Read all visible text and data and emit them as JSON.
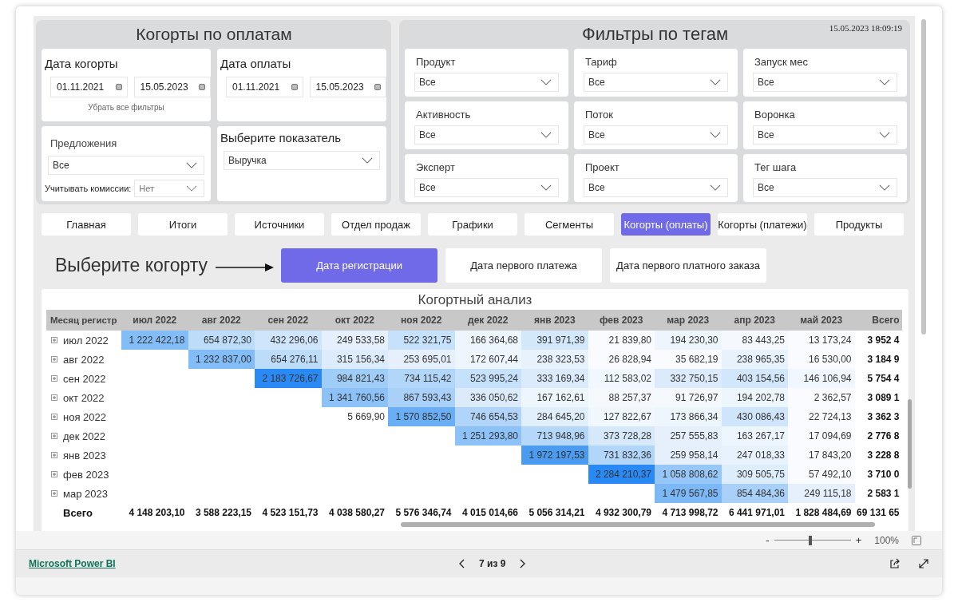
{
  "left_panel": {
    "title": "Когорты по оплатам",
    "cohort_date": {
      "label": "Дата когорты",
      "from": "01.11.2021",
      "to": "15.05.2023"
    },
    "clear_filters": "Убрать все фильтры",
    "payment_date": {
      "label": "Дата оплаты",
      "from": "01.11.2021",
      "to": "15.05.2023"
    },
    "offers": {
      "label": "Предложения",
      "value": "Все"
    },
    "commission": {
      "label": "Учитывать комиссии:",
      "value": "Нет"
    },
    "metric": {
      "label": "Выберите показатель",
      "value": "Выручка"
    }
  },
  "right_panel": {
    "title": "Фильтры по тегам",
    "timestamp": "15.05.2023 18:09:19",
    "filters": [
      {
        "label": "Продукт",
        "value": "Все"
      },
      {
        "label": "Тариф",
        "value": "Все"
      },
      {
        "label": "Запуск мес",
        "value": "Все"
      },
      {
        "label": "Активность",
        "value": "Все"
      },
      {
        "label": "Поток",
        "value": "Все"
      },
      {
        "label": "Воронка",
        "value": "Все"
      },
      {
        "label": "Эксперт",
        "value": "Все"
      },
      {
        "label": "Проект",
        "value": "Все"
      },
      {
        "label": "Тег шага",
        "value": "Все"
      }
    ]
  },
  "nav_tabs": [
    {
      "label": "Главная",
      "selected": false
    },
    {
      "label": "Итоги",
      "selected": false
    },
    {
      "label": "Источники",
      "selected": false
    },
    {
      "label": "Отдел продаж",
      "selected": false
    },
    {
      "label": "Графики",
      "selected": false
    },
    {
      "label": "Сегменты",
      "selected": false
    },
    {
      "label": "Когорты (оплаты)",
      "selected": true
    },
    {
      "label": "Когорты (платежи)",
      "selected": false
    },
    {
      "label": "Продукты",
      "selected": false
    }
  ],
  "cohort_picker": {
    "label": "Выберите когорту",
    "options": [
      {
        "label": "Дата регистрации",
        "selected": true
      },
      {
        "label": "Дата первого платежа",
        "selected": false
      },
      {
        "label": "Дата первого платного заказа",
        "selected": false
      }
    ]
  },
  "table": {
    "title": "Когортный анализ",
    "row_header": "Месяц регистр",
    "columns": [
      "июл 2022",
      "авг 2022",
      "сен 2022",
      "окт 2022",
      "ноя 2022",
      "дек 2022",
      "янв 2023",
      "фев 2023",
      "мар 2023",
      "апр 2023",
      "май 2023"
    ],
    "total_header": "Всего",
    "rows": [
      {
        "label": "июл 2022",
        "total": "3 952 4",
        "cells": [
          {
            "text": "1 222 422,18",
            "color": "#82bdf8"
          },
          {
            "text": "654 872,30",
            "color": "#bcdcfa"
          },
          {
            "text": "432 296,06",
            "color": "#cfe5fb"
          },
          {
            "text": "249 533,58",
            "color": "#e5f0fc"
          },
          {
            "text": "522 321,75",
            "color": "#c6e1fb"
          },
          {
            "text": "166 364,68",
            "color": "#edf5fd"
          },
          {
            "text": "391 971,39",
            "color": "#d4e8fb"
          },
          {
            "text": "21 839,80",
            "color": "#f9fbff"
          },
          {
            "text": "194 230,30",
            "color": "#edf5fd"
          },
          {
            "text": "83 443,25",
            "color": "#f5f9fe"
          },
          {
            "text": "13 173,24",
            "color": "#f9fbff"
          }
        ]
      },
      {
        "label": "авг 2022",
        "total": "3 184 9",
        "cells": [
          null,
          {
            "text": "1 232 837,00",
            "color": "#82bdf8"
          },
          {
            "text": "654 276,11",
            "color": "#bcdcfa"
          },
          {
            "text": "315 156,34",
            "color": "#ddecfc"
          },
          {
            "text": "253 695,01",
            "color": "#e5f0fc"
          },
          {
            "text": "172 607,44",
            "color": "#edf5fd"
          },
          {
            "text": "238 323,53",
            "color": "#e7f2fd"
          },
          {
            "text": "26 828,94",
            "color": "#f9fbff"
          },
          {
            "text": "35 682,19",
            "color": "#f9fbff"
          },
          {
            "text": "238 965,35",
            "color": "#e7f2fd"
          },
          {
            "text": "16 530,00",
            "color": "#f9fbff"
          }
        ]
      },
      {
        "label": "сен 2022",
        "total": "5 754 4",
        "cells": [
          null,
          null,
          {
            "text": "2 183 726,67",
            "color": "#2a8af5"
          },
          {
            "text": "984 821,43",
            "color": "#a0ccf8"
          },
          {
            "text": "734 115,42",
            "color": "#b2d6fa"
          },
          {
            "text": "523 995,24",
            "color": "#c6e1fb"
          },
          {
            "text": "333 169,34",
            "color": "#dbebfc"
          },
          {
            "text": "112 583,02",
            "color": "#f1f7fe"
          },
          {
            "text": "332 750,15",
            "color": "#dbebfc"
          },
          {
            "text": "403 154,56",
            "color": "#d2e7fb"
          },
          {
            "text": "146 106,94",
            "color": "#f1f7fe"
          }
        ]
      },
      {
        "label": "окт 2022",
        "total": "3 089 1",
        "cells": [
          null,
          null,
          null,
          {
            "text": "1 341 760,56",
            "color": "#8cc2f8"
          },
          {
            "text": "867 593,43",
            "color": "#a8d0f8"
          },
          {
            "text": "336 050,62",
            "color": "#dbebfc"
          },
          {
            "text": "167 162,61",
            "color": "#edf5fd"
          },
          {
            "text": "88 257,37",
            "color": "#f5f9fe"
          },
          {
            "text": "91 726,97",
            "color": "#f5f9fe"
          },
          {
            "text": "194 202,78",
            "color": "#edf5fd"
          },
          {
            "text": "2 362,57",
            "color": "#f9fbff"
          }
        ]
      },
      {
        "label": "ноя 2022",
        "total": "3 362 3",
        "cells": [
          null,
          null,
          null,
          {
            "text": "5 669,90",
            "color": "#ffffff"
          },
          {
            "text": "1 570 852,50",
            "color": "#6aaef5"
          },
          {
            "text": "746 654,53",
            "color": "#b0d4fa"
          },
          {
            "text": "284 645,20",
            "color": "#e1eefc"
          },
          {
            "text": "127 822,67",
            "color": "#f1f7fe"
          },
          {
            "text": "173 866,34",
            "color": "#edf5fd"
          },
          {
            "text": "430 086,43",
            "color": "#cfe5fb"
          },
          {
            "text": "22 724,13",
            "color": "#f9fbff"
          }
        ]
      },
      {
        "label": "дек 2022",
        "total": "2 776 8",
        "cells": [
          null,
          null,
          null,
          null,
          null,
          {
            "text": "1 251 293,80",
            "color": "#8cc2f8"
          },
          {
            "text": "713 948,96",
            "color": "#b4d7fa"
          },
          {
            "text": "373 728,28",
            "color": "#d6e9fb"
          },
          {
            "text": "257 555,83",
            "color": "#e5f0fc"
          },
          {
            "text": "163 267,17",
            "color": "#edf5fd"
          },
          {
            "text": "17 094,69",
            "color": "#f9fbff"
          }
        ]
      },
      {
        "label": "янв 2023",
        "total": "3 228 8",
        "cells": [
          null,
          null,
          null,
          null,
          null,
          null,
          {
            "text": "1 972 197,53",
            "color": "#4b9cf0"
          },
          {
            "text": "731 832,36",
            "color": "#b2d6fa"
          },
          {
            "text": "259 958,14",
            "color": "#e5f0fc"
          },
          {
            "text": "247 018,33",
            "color": "#e7f2fd"
          },
          {
            "text": "17 843,20",
            "color": "#f9fbff"
          }
        ]
      },
      {
        "label": "фев 2023",
        "total": "3 710 0",
        "cells": [
          null,
          null,
          null,
          null,
          null,
          null,
          null,
          {
            "text": "2 284 210,37",
            "color": "#2a8af5"
          },
          {
            "text": "1 058 808,62",
            "color": "#96c7f8"
          },
          {
            "text": "309 505,75",
            "color": "#deedfc"
          },
          {
            "text": "57 492,10",
            "color": "#f9fbff"
          }
        ]
      },
      {
        "label": "мар 2023",
        "total": "2 583 1",
        "cells": [
          null,
          null,
          null,
          null,
          null,
          null,
          null,
          null,
          {
            "text": "1 479 567,85",
            "color": "#7cb8f6"
          },
          {
            "text": "854 484,36",
            "color": "#a8d0f8"
          },
          {
            "text": "249 115,18",
            "color": "#e5f0fc"
          }
        ]
      }
    ],
    "total_row": {
      "label": "Всего",
      "total": "69 131 65",
      "cells": [
        "4 148 203,10",
        "3 588 223,15",
        "4 523 151,73",
        "4 038 580,27",
        "5 576 346,74",
        "4 015 014,66",
        "5 056 314,21",
        "4 932 300,79",
        "4 713 998,72",
        "6 441 971,01",
        "1 828 484,69"
      ]
    }
  },
  "zoom": {
    "minus": "-",
    "plus": "+",
    "level": 0.45,
    "percent": "100%"
  },
  "footer": {
    "brand_link": "Microsoft Power BI",
    "page_indicator": "7 из 9"
  }
}
